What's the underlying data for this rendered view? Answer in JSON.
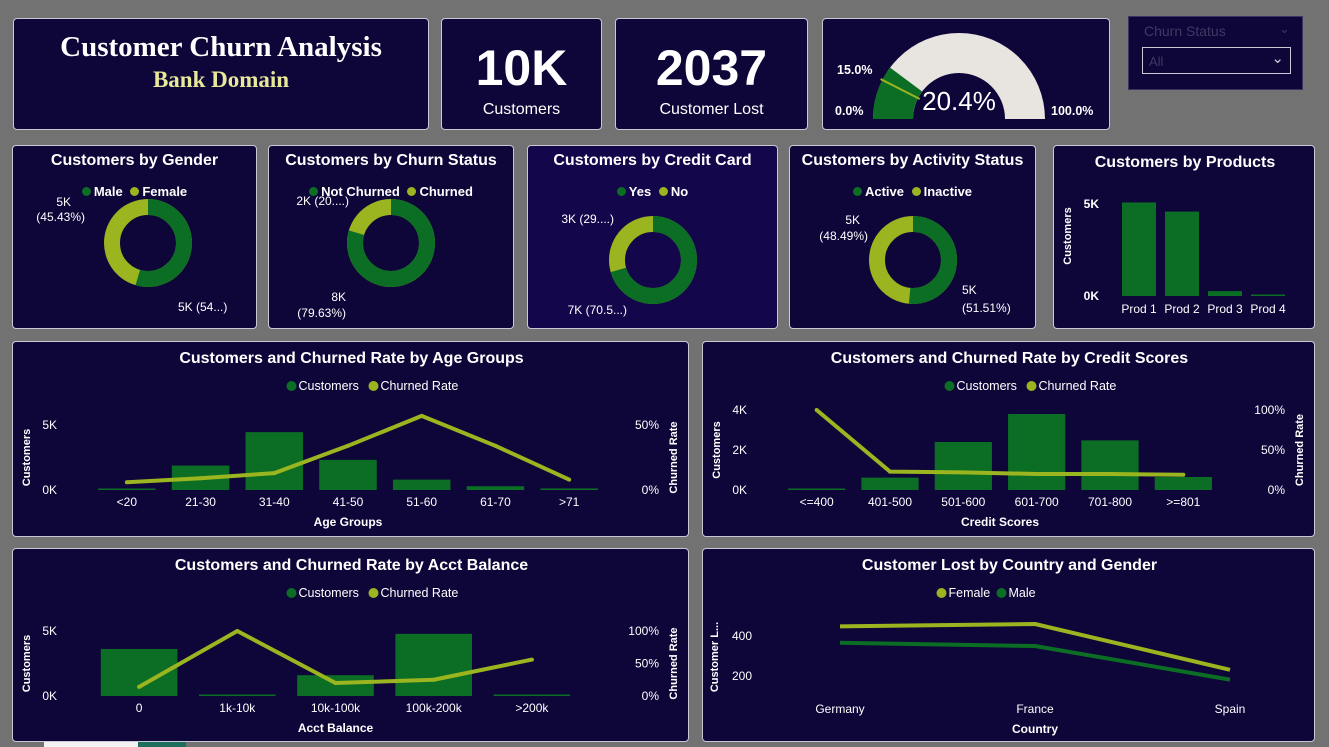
{
  "colors": {
    "dark_green": "#0b6e24",
    "light_green": "#9ab51f",
    "panel": "#0e0538",
    "title_yellow": "#e8e89a",
    "gauge_bg": "#e8e4df"
  },
  "header": {
    "title": "Customer Churn Analysis",
    "subtitle": "Bank Domain"
  },
  "kpis": [
    {
      "value": "10K",
      "label": "Customers"
    },
    {
      "value": "2037",
      "label": "Customer Lost"
    }
  ],
  "gauge": {
    "value_label": "20.4%",
    "min_label": "0.0%",
    "max_label": "100.0%",
    "target_label": "15.0%",
    "value": 0.204,
    "target": 0.15
  },
  "filter": {
    "label": "Churn Status",
    "selected": "All"
  },
  "donuts": [
    {
      "title": "Customers by Gender",
      "legend": [
        "Male",
        "Female"
      ],
      "primary_fraction": 0.5457,
      "label_a": "5K",
      "label_a2": "(45.43%)",
      "label_b": "5K (54...)"
    },
    {
      "title": "Customers by Churn Status",
      "legend": [
        "Not Churned",
        "Churned"
      ],
      "primary_fraction": 0.7963,
      "label_a": "2K (20....)",
      "label_b": "8K",
      "label_b2": "(79.63%)"
    },
    {
      "title": "Customers by Credit Card",
      "legend": [
        "Yes",
        "No"
      ],
      "primary_fraction": 0.7055,
      "label_a": "3K (29....)",
      "label_b": "7K (70.5...)"
    },
    {
      "title": "Customers by Activity Status",
      "legend": [
        "Active",
        "Inactive"
      ],
      "primary_fraction": 0.5151,
      "label_a": "5K",
      "label_a2": "(48.49%)",
      "label_b": "5K",
      "label_b2": "(51.51%)"
    }
  ],
  "chart_data": [
    {
      "type": "bar",
      "title": "Customers by Products",
      "categories": [
        "Prod 1",
        "Prod 2",
        "Prod 3",
        "Prod 4"
      ],
      "values": [
        5084,
        4590,
        266,
        60
      ],
      "ylabel": "Customers",
      "yticks": [
        "5K",
        "0K"
      ],
      "ylim": [
        0,
        5000
      ]
    },
    {
      "type": "bar+line",
      "title": "Customers and Churned Rate by Age Groups",
      "legend": [
        "Customers",
        "Churned Rate"
      ],
      "categories": [
        "<20",
        "21-30",
        "31-40",
        "41-50",
        "51-60",
        "61-70",
        ">71"
      ],
      "bars": [
        90,
        1880,
        4450,
        2320,
        800,
        290,
        120
      ],
      "line": [
        0.06,
        0.09,
        0.13,
        0.34,
        0.57,
        0.34,
        0.08
      ],
      "xlabel": "Age Groups",
      "ylabel": "Customers",
      "y2label": "Churned Rate",
      "ylim": [
        0,
        5000
      ],
      "y2lim": [
        0,
        0.5
      ],
      "yticks": [
        "5K",
        "0K"
      ],
      "y2ticks": [
        "50%",
        "0%"
      ]
    },
    {
      "type": "bar+line",
      "title": "Customers and Churned Rate by Credit Scores",
      "legend": [
        "Customers",
        "Churned Rate"
      ],
      "categories": [
        "<=400",
        "401-500",
        "501-600",
        "601-700",
        "701-800",
        ">=801"
      ],
      "bars": [
        19,
        620,
        2400,
        3800,
        2480,
        650
      ],
      "line": [
        1.0,
        0.23,
        0.22,
        0.2,
        0.2,
        0.19
      ],
      "xlabel": "Credit Scores",
      "ylabel": "Customers",
      "y2label": "Churned Rate",
      "ylim": [
        0,
        4000
      ],
      "y2lim": [
        0,
        1.0
      ],
      "yticks": [
        "4K",
        "2K",
        "0K"
      ],
      "y2ticks": [
        "100%",
        "50%",
        "0%"
      ]
    },
    {
      "type": "bar+line",
      "title": "Customers and Churned Rate by Acct Balance",
      "legend": [
        "Customers",
        "Churned Rate"
      ],
      "categories": [
        "0",
        "1k-10k",
        "10k-100k",
        "100k-200k",
        ">200k"
      ],
      "bars": [
        3620,
        40,
        1600,
        4780,
        60
      ],
      "line": [
        0.14,
        1.0,
        0.2,
        0.25,
        0.56
      ],
      "xlabel": "Acct Balance",
      "ylabel": "Customers",
      "y2label": "Churned Rate",
      "ylim": [
        0,
        5000
      ],
      "y2lim": [
        0,
        1.0
      ],
      "yticks": [
        "5K",
        "0K"
      ],
      "y2ticks": [
        "100%",
        "50%",
        "0%"
      ]
    },
    {
      "type": "line",
      "title": "Customer Lost by Country and Gender",
      "legend": [
        "Female",
        "Male"
      ],
      "categories": [
        "Germany",
        "France",
        "Spain"
      ],
      "series": [
        {
          "name": "Female",
          "values": [
            448,
            460,
            231
          ]
        },
        {
          "name": "Male",
          "values": [
            366,
            350,
            182
          ]
        }
      ],
      "xlabel": "Country",
      "ylabel": "Customer L...",
      "ylim": [
        150,
        500
      ],
      "yticks": [
        "400",
        "200"
      ]
    }
  ]
}
